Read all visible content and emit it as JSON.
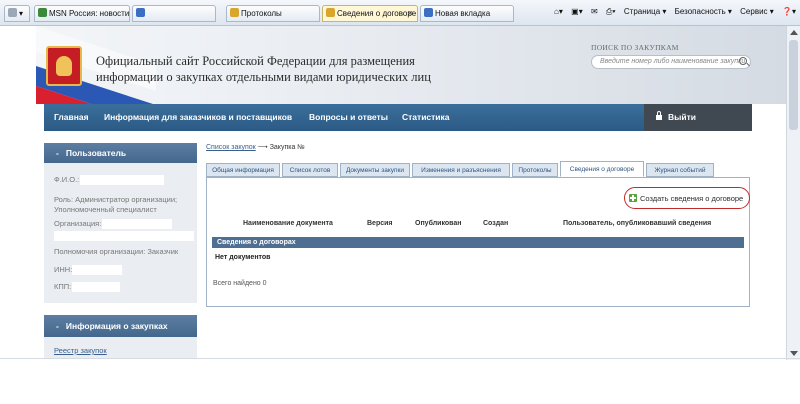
{
  "browser": {
    "tabs": [
      {
        "label": "MSN Россия: новости, ...",
        "active": false
      },
      {
        "label": "",
        "active": false
      },
      {
        "label": "Протоколы",
        "active": false
      },
      {
        "label": "Сведения о договоре",
        "active": true
      },
      {
        "label": "Новая вкладка",
        "active": false
      }
    ],
    "close_glyph": "×",
    "commands": [
      "Страница ▾",
      "Безопасность ▾",
      "Сервис ▾",
      "❓▾"
    ]
  },
  "header": {
    "title_line1": "Официальный сайт Российской Федерации для размещения",
    "title_line2": "информации о закупках отдельными видами юридических лиц",
    "search_label": "ПОИСК ПО ЗАКУПКАМ",
    "search_placeholder": "Введите номер либо наименование закупки"
  },
  "nav": {
    "items": [
      "Главная",
      "Информация для заказчиков и поставщиков",
      "Вопросы и ответы",
      "Статистика"
    ],
    "exit_label": "Выйти"
  },
  "sidebar": {
    "user_title": "Пользователь",
    "fio_label": "Ф.И.О.:",
    "role_text": "Роль: Администратор организации; Уполномоченный специалист",
    "org_label": "Организация:",
    "authority_text": "Полномочия организации: Заказчик",
    "inn_label": "ИНН:",
    "kpp_label": "КПП:",
    "purchases_title": "Информация о закупках",
    "registry_link": "Реестр закупок"
  },
  "breadcrumb": {
    "link": "Список закупок",
    "arrow": "⟶",
    "current": "Закупка №"
  },
  "content_tabs": [
    {
      "label": "Общая информация",
      "active": false
    },
    {
      "label": "Список лотов",
      "active": false
    },
    {
      "label": "Документы закупки",
      "active": false
    },
    {
      "label": "Изменения и разъяснения",
      "active": false
    },
    {
      "label": "Протоколы",
      "active": false
    },
    {
      "label": "Сведения о договоре",
      "active": true
    },
    {
      "label": "Журнал событий",
      "active": false
    }
  ],
  "contract": {
    "create_button": "Создать сведения о договоре",
    "columns": [
      "Наименование документа",
      "Версия",
      "Опубликован",
      "Создан",
      "Пользователь, опубликовавший сведения"
    ],
    "section_title": "Сведения о договорах",
    "empty_text": "Нет документов",
    "total_text": "Всего найдено 0"
  },
  "colors": {
    "nav": "#2b5a85",
    "exit": "#404852",
    "accent_ring": "#c22a2a",
    "section_bar": "#4f6f92"
  }
}
